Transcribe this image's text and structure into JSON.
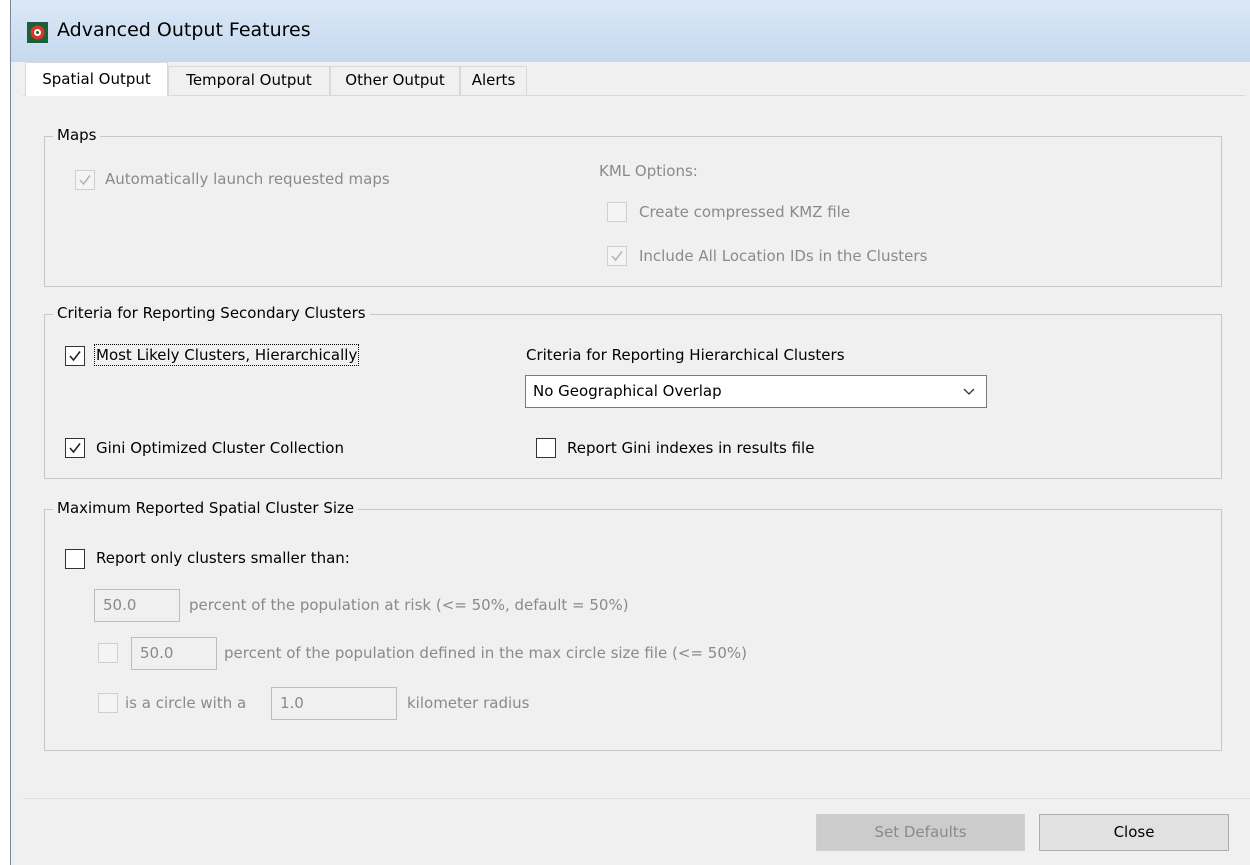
{
  "window": {
    "title": "Advanced Output Features"
  },
  "tabs": [
    {
      "label": "Spatial Output",
      "active": true
    },
    {
      "label": "Temporal Output",
      "active": false
    },
    {
      "label": "Other Output",
      "active": false
    },
    {
      "label": "Alerts",
      "active": false
    }
  ],
  "maps": {
    "title": "Maps",
    "auto_launch": {
      "label": "Automatically launch requested maps",
      "checked": true,
      "enabled": false
    },
    "kml_label": "KML Options:",
    "kmz": {
      "label": "Create compressed KMZ file",
      "checked": false,
      "enabled": false
    },
    "include_ids": {
      "label": "Include All Location IDs in the Clusters",
      "checked": true,
      "enabled": false
    }
  },
  "secondary": {
    "title": "Criteria for Reporting Secondary Clusters",
    "most_likely": {
      "label": "Most Likely Clusters, Hierarchically",
      "checked": true
    },
    "hier_criteria_label": "Criteria for Reporting Hierarchical Clusters",
    "hier_criteria_value": "No Geographical Overlap",
    "gini": {
      "label": "Gini Optimized Cluster Collection",
      "checked": true
    },
    "gini_report": {
      "label": "Report Gini indexes in results file",
      "checked": false
    }
  },
  "maxsize": {
    "title": "Maximum Reported Spatial Cluster Size",
    "report_only": {
      "label": "Report only clusters smaller than:",
      "checked": false
    },
    "pop_value": "50.0",
    "pop_label": "percent of the population at risk (<= 50%, default = 50%)",
    "maxcircle_checked": false,
    "maxcircle_value": "50.0",
    "maxcircle_label": "percent of the population defined in the max circle size file (<= 50%)",
    "radius_checked": false,
    "radius_prefix": "is a circle with a",
    "radius_value": "1.0",
    "radius_suffix": "kilometer radius"
  },
  "buttons": {
    "set_defaults": "Set Defaults",
    "close": "Close"
  },
  "colors": {
    "titlebar": "#c5d9ef",
    "background": "#f0f0f0",
    "disabled_text": "#8a8a8a"
  }
}
